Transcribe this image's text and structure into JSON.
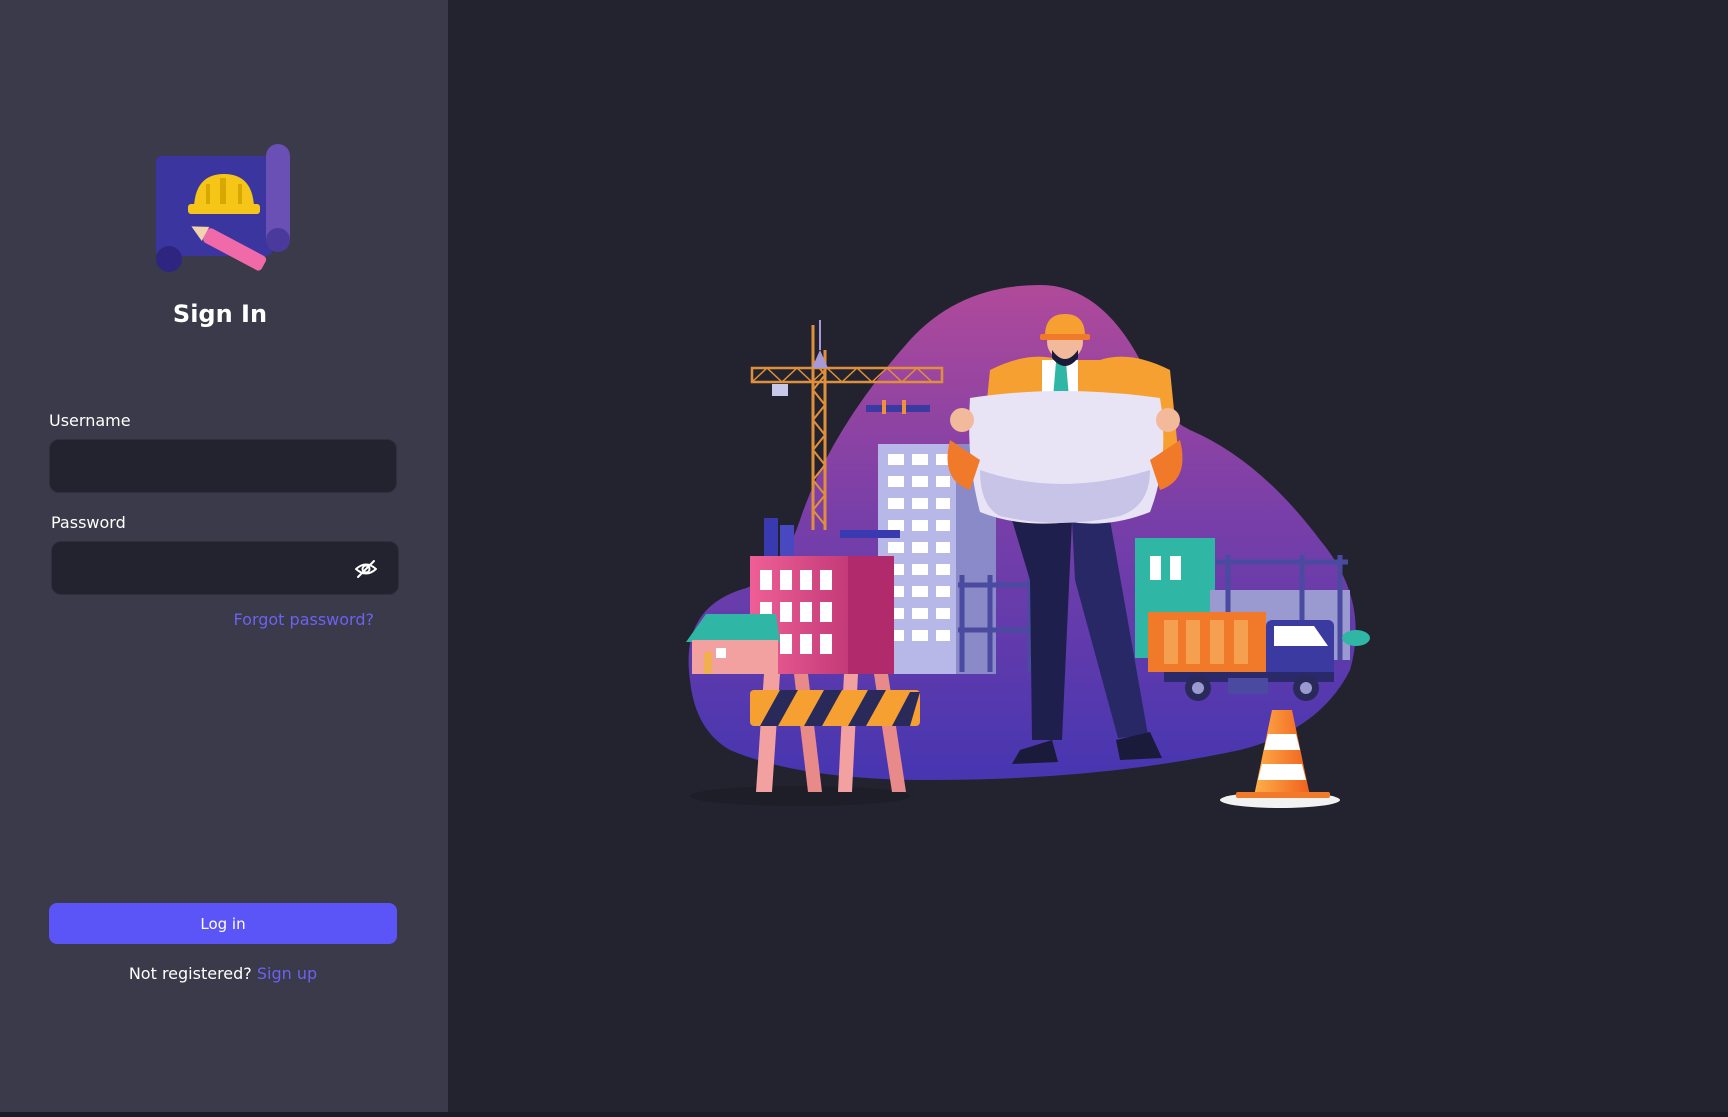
{
  "auth": {
    "title": "Sign In",
    "username_label": "Username",
    "username_value": "",
    "password_label": "Password",
    "password_value": "",
    "forgot_password": "Forgot password?",
    "login_button": "Log in",
    "register_prompt": "Not registered?",
    "signup_link": "Sign up"
  },
  "icons": {
    "logo": "blueprint-helmet-pencil-logo",
    "password_toggle": "eye-slash-icon"
  },
  "colors": {
    "panel": "#3a3a4a",
    "background": "#23232f",
    "input": "#23232f",
    "accent": "#5b54f6",
    "link": "#6b62f0",
    "helmet": "#f5c518",
    "pencil": "#f06aa9"
  }
}
